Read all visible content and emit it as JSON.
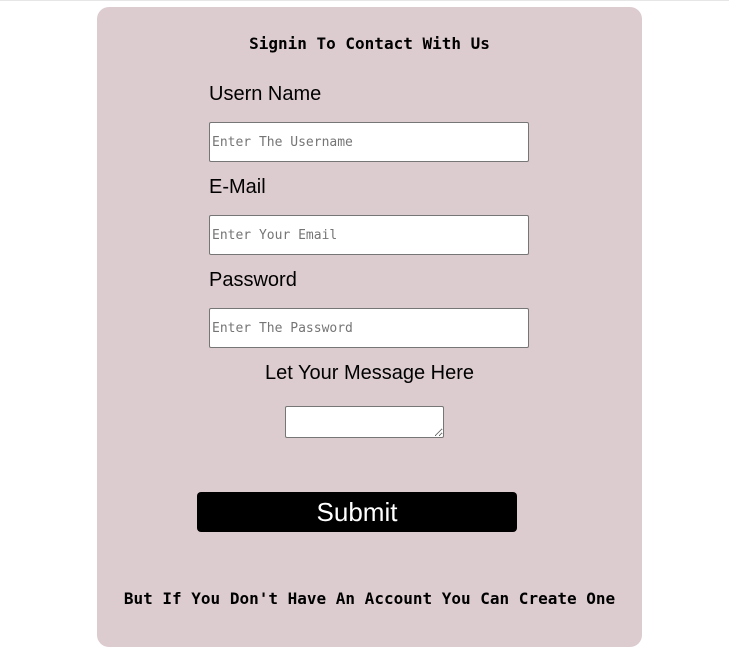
{
  "form": {
    "title": "Signin To Contact With Us",
    "username": {
      "label": "Usern Name",
      "placeholder": "Enter The Username"
    },
    "email": {
      "label": "E-Mail",
      "placeholder": "Enter Your Email"
    },
    "password": {
      "label": "Password",
      "placeholder": "Enter The Password"
    },
    "message": {
      "label": "Let Your Message Here"
    },
    "submit_label": "Submit",
    "footer_text": "But If You Don't Have An Account You Can Create One"
  },
  "colors": {
    "card_background": "#dccbcf",
    "button_background": "#000000",
    "button_text": "#ffffff"
  }
}
